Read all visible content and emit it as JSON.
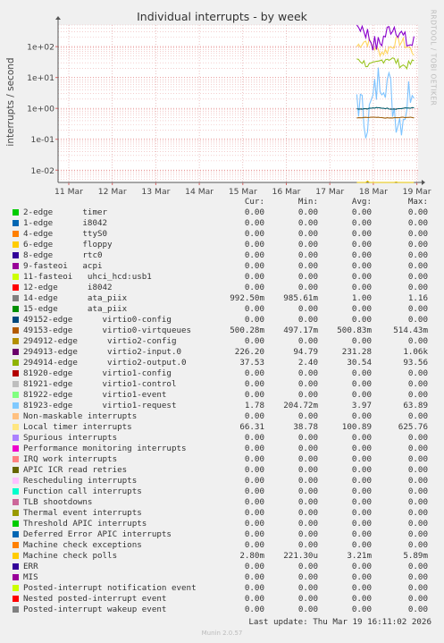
{
  "chart_data": {
    "type": "line",
    "title": "Individual interrupts - by week",
    "ylabel": "interrupts / second",
    "yscale": "log",
    "ylim": [
      0.004,
      500
    ],
    "yticks": [
      "1e+02",
      "1e+01",
      "1e+00",
      "1e-01",
      "1e-02"
    ],
    "ytick_values": [
      100,
      10,
      1,
      0.1,
      0.01
    ],
    "xticks": [
      "11 Mar",
      "12 Mar",
      "13 Mar",
      "14 Mar",
      "15 Mar",
      "16 Mar",
      "17 Mar",
      "18 Mar",
      "19 Mar"
    ],
    "grid": true,
    "series": [
      {
        "name": "Local timer interrupts",
        "color": "#ffd660",
        "level": 100,
        "amp": 0.35
      },
      {
        "name": "294913-edge virtio2-input.0",
        "color": "#8a00cc",
        "level": 230,
        "amp": 0.6
      },
      {
        "name": "294914-edge virtio2-output.0",
        "color": "#9ac420",
        "level": 32,
        "amp": 0.25
      },
      {
        "name": "81923-edge virtio1-request",
        "color": "#7dc3ff",
        "level": 2.5,
        "amp": 1.4
      },
      {
        "name": "14-edge ata_piix",
        "color": "#005a6a",
        "level": 1.0,
        "amp": 0.03
      },
      {
        "name": "49153-edge virtio0-virtqueues",
        "color": "#a06010",
        "level": 0.5,
        "amp": 0.02
      },
      {
        "name": "Machine check polls",
        "color": "#e8c600",
        "level": 0.0032,
        "amp": 0.15
      }
    ]
  },
  "legend": {
    "headers": [
      "Cur:",
      "Min:",
      "Avg:",
      "Max:"
    ],
    "rows": [
      {
        "color": "#00cc00",
        "name": "2-edge      timer",
        "cur": "0.00",
        "min": "0.00",
        "avg": "0.00",
        "max": "0.00"
      },
      {
        "color": "#0066b3",
        "name": "1-edge      i8042",
        "cur": "0.00",
        "min": "0.00",
        "avg": "0.00",
        "max": "0.00"
      },
      {
        "color": "#ff8000",
        "name": "4-edge      ttyS0",
        "cur": "0.00",
        "min": "0.00",
        "avg": "0.00",
        "max": "0.00"
      },
      {
        "color": "#ffcc00",
        "name": "6-edge      floppy",
        "cur": "0.00",
        "min": "0.00",
        "avg": "0.00",
        "max": "0.00"
      },
      {
        "color": "#330099",
        "name": "8-edge      rtc0",
        "cur": "0.00",
        "min": "0.00",
        "avg": "0.00",
        "max": "0.00"
      },
      {
        "color": "#990099",
        "name": "9-fasteoi   acpi",
        "cur": "0.00",
        "min": "0.00",
        "avg": "0.00",
        "max": "0.00"
      },
      {
        "color": "#ccff00",
        "name": "11-fasteoi   uhci_hcd:usb1",
        "cur": "0.00",
        "min": "0.00",
        "avg": "0.00",
        "max": "0.00"
      },
      {
        "color": "#ff0000",
        "name": "12-edge      i8042",
        "cur": "0.00",
        "min": "0.00",
        "avg": "0.00",
        "max": "0.00"
      },
      {
        "color": "#808080",
        "name": "14-edge      ata_piix",
        "cur": "992.50m",
        "min": "985.61m",
        "avg": "1.00",
        "max": "1.16"
      },
      {
        "color": "#008f00",
        "name": "15-edge      ata_piix",
        "cur": "0.00",
        "min": "0.00",
        "avg": "0.00",
        "max": "0.00"
      },
      {
        "color": "#00487d",
        "name": "49152-edge      virtio0-config",
        "cur": "0.00",
        "min": "0.00",
        "avg": "0.00",
        "max": "0.00"
      },
      {
        "color": "#b35a00",
        "name": "49153-edge      virtio0-virtqueues",
        "cur": "500.28m",
        "min": "497.17m",
        "avg": "500.83m",
        "max": "514.43m"
      },
      {
        "color": "#b38f00",
        "name": "294912-edge      virtio2-config",
        "cur": "0.00",
        "min": "0.00",
        "avg": "0.00",
        "max": "0.00"
      },
      {
        "color": "#6b006b",
        "name": "294913-edge      virtio2-input.0",
        "cur": "226.20",
        "min": "94.79",
        "avg": "231.28",
        "max": "1.06k"
      },
      {
        "color": "#8fb300",
        "name": "294914-edge      virtio2-output.0",
        "cur": "37.53",
        "min": "2.40",
        "avg": "30.54",
        "max": "93.56"
      },
      {
        "color": "#b30000",
        "name": "81920-edge      virtio1-config",
        "cur": "0.00",
        "min": "0.00",
        "avg": "0.00",
        "max": "0.00"
      },
      {
        "color": "#bebebe",
        "name": "81921-edge      virtio1-control",
        "cur": "0.00",
        "min": "0.00",
        "avg": "0.00",
        "max": "0.00"
      },
      {
        "color": "#80ff80",
        "name": "81922-edge      virtio1-event",
        "cur": "0.00",
        "min": "0.00",
        "avg": "0.00",
        "max": "0.00"
      },
      {
        "color": "#80c9ff",
        "name": "81923-edge      virtio1-request",
        "cur": "1.78",
        "min": "204.72m",
        "avg": "3.97",
        "max": "63.89"
      },
      {
        "color": "#ffc080",
        "name": "Non-maskable interrupts",
        "cur": "0.00",
        "min": "0.00",
        "avg": "0.00",
        "max": "0.00"
      },
      {
        "color": "#ffe680",
        "name": "Local timer interrupts",
        "cur": "66.31",
        "min": "38.78",
        "avg": "100.89",
        "max": "625.76"
      },
      {
        "color": "#aa80ff",
        "name": "Spurious interrupts",
        "cur": "0.00",
        "min": "0.00",
        "avg": "0.00",
        "max": "0.00"
      },
      {
        "color": "#ee00cc",
        "name": "Performance monitoring interrupts",
        "cur": "0.00",
        "min": "0.00",
        "avg": "0.00",
        "max": "0.00"
      },
      {
        "color": "#ff8080",
        "name": "IRQ work interrupts",
        "cur": "0.00",
        "min": "0.00",
        "avg": "0.00",
        "max": "0.00"
      },
      {
        "color": "#666600",
        "name": "APIC ICR read retries",
        "cur": "0.00",
        "min": "0.00",
        "avg": "0.00",
        "max": "0.00"
      },
      {
        "color": "#ffbfff",
        "name": "Rescheduling interrupts",
        "cur": "0.00",
        "min": "0.00",
        "avg": "0.00",
        "max": "0.00"
      },
      {
        "color": "#00ffcc",
        "name": "Function call interrupts",
        "cur": "0.00",
        "min": "0.00",
        "avg": "0.00",
        "max": "0.00"
      },
      {
        "color": "#cc6699",
        "name": "TLB shootdowns",
        "cur": "0.00",
        "min": "0.00",
        "avg": "0.00",
        "max": "0.00"
      },
      {
        "color": "#999900",
        "name": "Thermal event interrupts",
        "cur": "0.00",
        "min": "0.00",
        "avg": "0.00",
        "max": "0.00"
      },
      {
        "color": "#00cc00",
        "name": "Threshold APIC interrupts",
        "cur": "0.00",
        "min": "0.00",
        "avg": "0.00",
        "max": "0.00"
      },
      {
        "color": "#0066b3",
        "name": "Deferred Error APIC interrupts",
        "cur": "0.00",
        "min": "0.00",
        "avg": "0.00",
        "max": "0.00"
      },
      {
        "color": "#ff8000",
        "name": "Machine check exceptions",
        "cur": "0.00",
        "min": "0.00",
        "avg": "0.00",
        "max": "0.00"
      },
      {
        "color": "#ffcc00",
        "name": "Machine check polls",
        "cur": "2.80m",
        "min": "221.30u",
        "avg": "3.21m",
        "max": "5.89m"
      },
      {
        "color": "#330099",
        "name": "ERR",
        "cur": "0.00",
        "min": "0.00",
        "avg": "0.00",
        "max": "0.00"
      },
      {
        "color": "#990099",
        "name": "MIS",
        "cur": "0.00",
        "min": "0.00",
        "avg": "0.00",
        "max": "0.00"
      },
      {
        "color": "#ccff00",
        "name": "Posted-interrupt notification event",
        "cur": "0.00",
        "min": "0.00",
        "avg": "0.00",
        "max": "0.00"
      },
      {
        "color": "#ff0000",
        "name": "Nested posted-interrupt event",
        "cur": "0.00",
        "min": "0.00",
        "avg": "0.00",
        "max": "0.00"
      },
      {
        "color": "#808080",
        "name": "Posted-interrupt wakeup event",
        "cur": "0.00",
        "min": "0.00",
        "avg": "0.00",
        "max": "0.00"
      }
    ]
  },
  "last_update": "Last update: Thu Mar 19 16:11:02 2026",
  "vendor_label": "RRDTOOL / TOBI OETIKER",
  "footer": "Munin 2.0.57"
}
